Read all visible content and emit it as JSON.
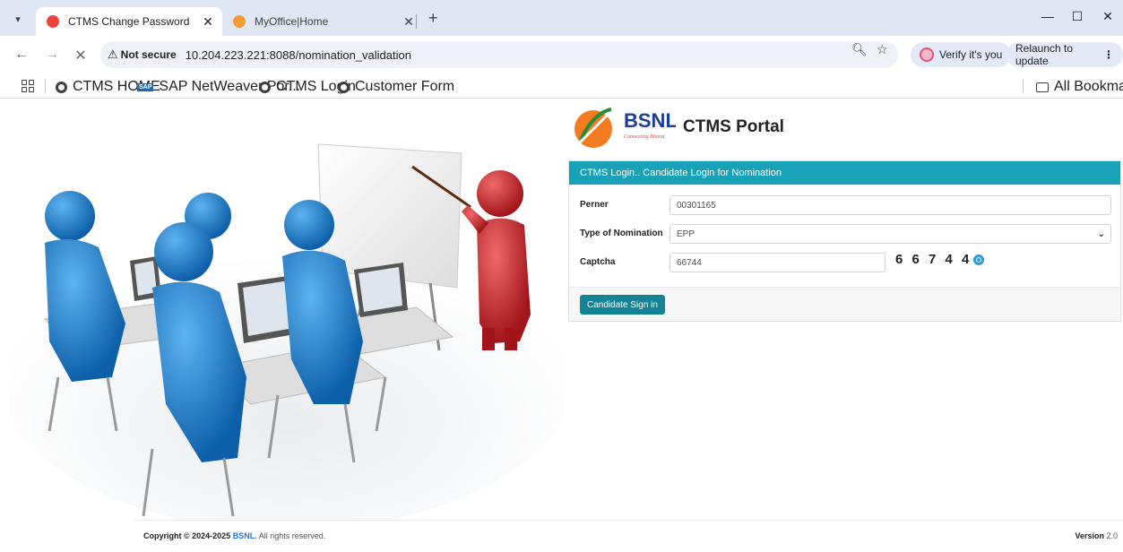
{
  "browser": {
    "tabs": [
      {
        "title": "CTMS Change Password",
        "active": true,
        "favicon_color": "#e8453c"
      },
      {
        "title": "MyOffice|Home",
        "active": false,
        "favicon_color": "#f29b38"
      }
    ],
    "security_label": "Not secure",
    "url": "10.204.223.221:8088/nomination_validation",
    "verify_label": "Verify it's you",
    "relaunch_label": "Relaunch to update",
    "bookmarks": [
      "CTMS HOME",
      "SAP NetWeaver Por...",
      "CTMS Login",
      "Customer Form"
    ],
    "all_bookmarks_label": "All Bookmarks"
  },
  "brand": {
    "logo_text": "BSNL",
    "logo_tagline": "Connecting Bharat",
    "portal_title": "CTMS Portal",
    "accent_color": "#17a2b8"
  },
  "login_card": {
    "header": "CTMS Login.. Candidate Login for Nomination",
    "perner_label": "Perner",
    "perner_value": "00301165",
    "nomination_type_label": "Type of Nomination",
    "nomination_type_value": "EPP",
    "captcha_label": "Captcha",
    "captcha_value": "66744",
    "captcha_image_text": "6 6 7 4 4",
    "signin_label": "Candidate Sign in"
  },
  "footer": {
    "copyright_prefix": "Copyright © 2024-2025",
    "copyright_brand": "BSNL.",
    "copyright_suffix": "All rights reserved.",
    "version_label": "Version",
    "version_value": "2.0"
  }
}
